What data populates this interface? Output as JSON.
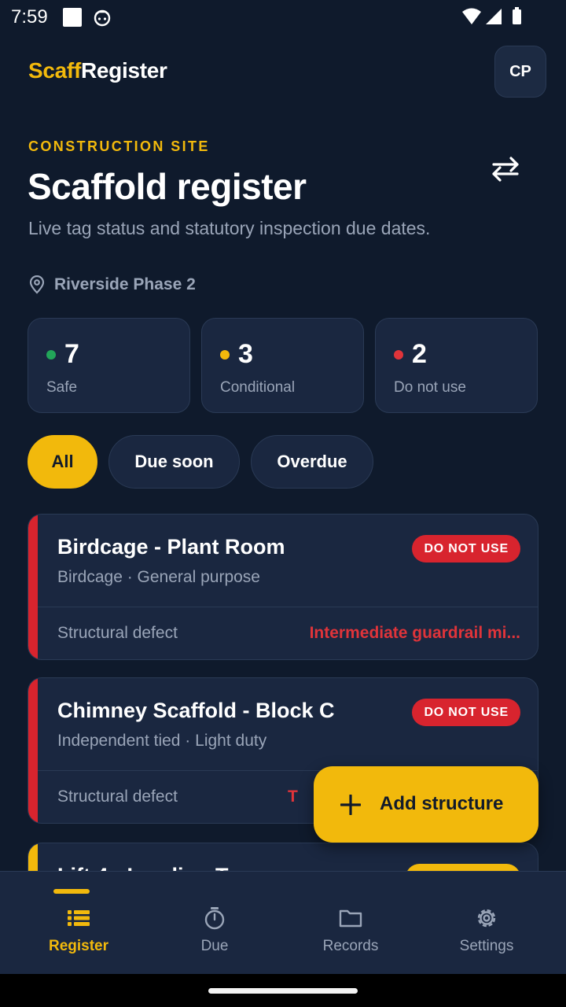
{
  "status_bar": {
    "time": "7:59"
  },
  "header": {
    "brand_accent": "Scaff",
    "brand_rest": "Register",
    "avatar_initials": "CP"
  },
  "page": {
    "eyebrow": "CONSTRUCTION SITE",
    "title": "Scaffold register",
    "subtitle": "Live tag status and statutory inspection due dates.",
    "location": "Riverside Phase 2"
  },
  "stats": [
    {
      "value": "7",
      "label": "Safe",
      "color": "#22a559"
    },
    {
      "value": "3",
      "label": "Conditional",
      "color": "#f2b90c"
    },
    {
      "value": "2",
      "label": "Do not use",
      "color": "#e0343a"
    }
  ],
  "filters": [
    {
      "label": "All",
      "active": true
    },
    {
      "label": "Due soon",
      "active": false
    },
    {
      "label": "Overdue",
      "active": false
    }
  ],
  "structures": [
    {
      "name": "Birdcage - Plant Room",
      "type": "Birdcage · General purpose",
      "status": "DO NOT USE",
      "issue": "Structural defect",
      "note": "Intermediate guardrail mi..."
    },
    {
      "name": "Chimney Scaffold - Block C",
      "type": "Independent tied · Light duty",
      "status": "DO NOT USE",
      "issue": "Structural defect",
      "note": "T"
    },
    {
      "name": "Lift 4 - Loading T",
      "status_color": "#f2b90c"
    }
  ],
  "fab": {
    "label": "Add structure"
  },
  "bottom_nav": [
    {
      "label": "Register",
      "icon": "list-icon",
      "active": true
    },
    {
      "label": "Due",
      "icon": "timer-icon",
      "active": false
    },
    {
      "label": "Records",
      "icon": "folder-icon",
      "active": false
    },
    {
      "label": "Settings",
      "icon": "gear-icon",
      "active": false
    }
  ],
  "colors": {
    "accent": "#f2b90c",
    "danger": "#d8242e",
    "background": "#0f1a2c",
    "surface": "#1a2740"
  }
}
